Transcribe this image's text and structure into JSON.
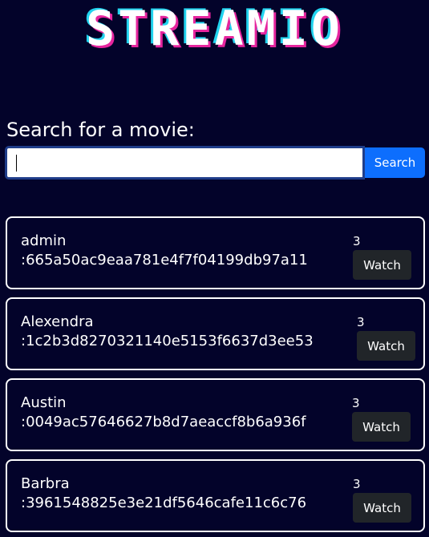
{
  "header": {
    "logo_text": "STREAMIO"
  },
  "search": {
    "heading": "Search for a movie:",
    "value": "",
    "button_label": "Search"
  },
  "results": [
    {
      "title": "admin",
      "hash": ":665a50ac9eaa781e4f7f04199db97a11",
      "count": "3",
      "watch_label": "Watch"
    },
    {
      "title": "Alexendra",
      "hash": ":1c2b3d8270321140e5153f6637d3ee53",
      "count": "3",
      "watch_label": "Watch"
    },
    {
      "title": "Austin",
      "hash": ":0049ac57646627b8d7aeaccf8b6a936f",
      "count": "3",
      "watch_label": "Watch"
    },
    {
      "title": "Barbra",
      "hash": ":3961548825e3e21df5646cafe11c6c76",
      "count": "3",
      "watch_label": "Watch"
    }
  ],
  "colors": {
    "background": "#03032a",
    "search_button": "#0d6efd",
    "watch_button": "#212529",
    "logo_shadow_pink": "#e6259e",
    "logo_shadow_cyan": "#22d3ee"
  }
}
